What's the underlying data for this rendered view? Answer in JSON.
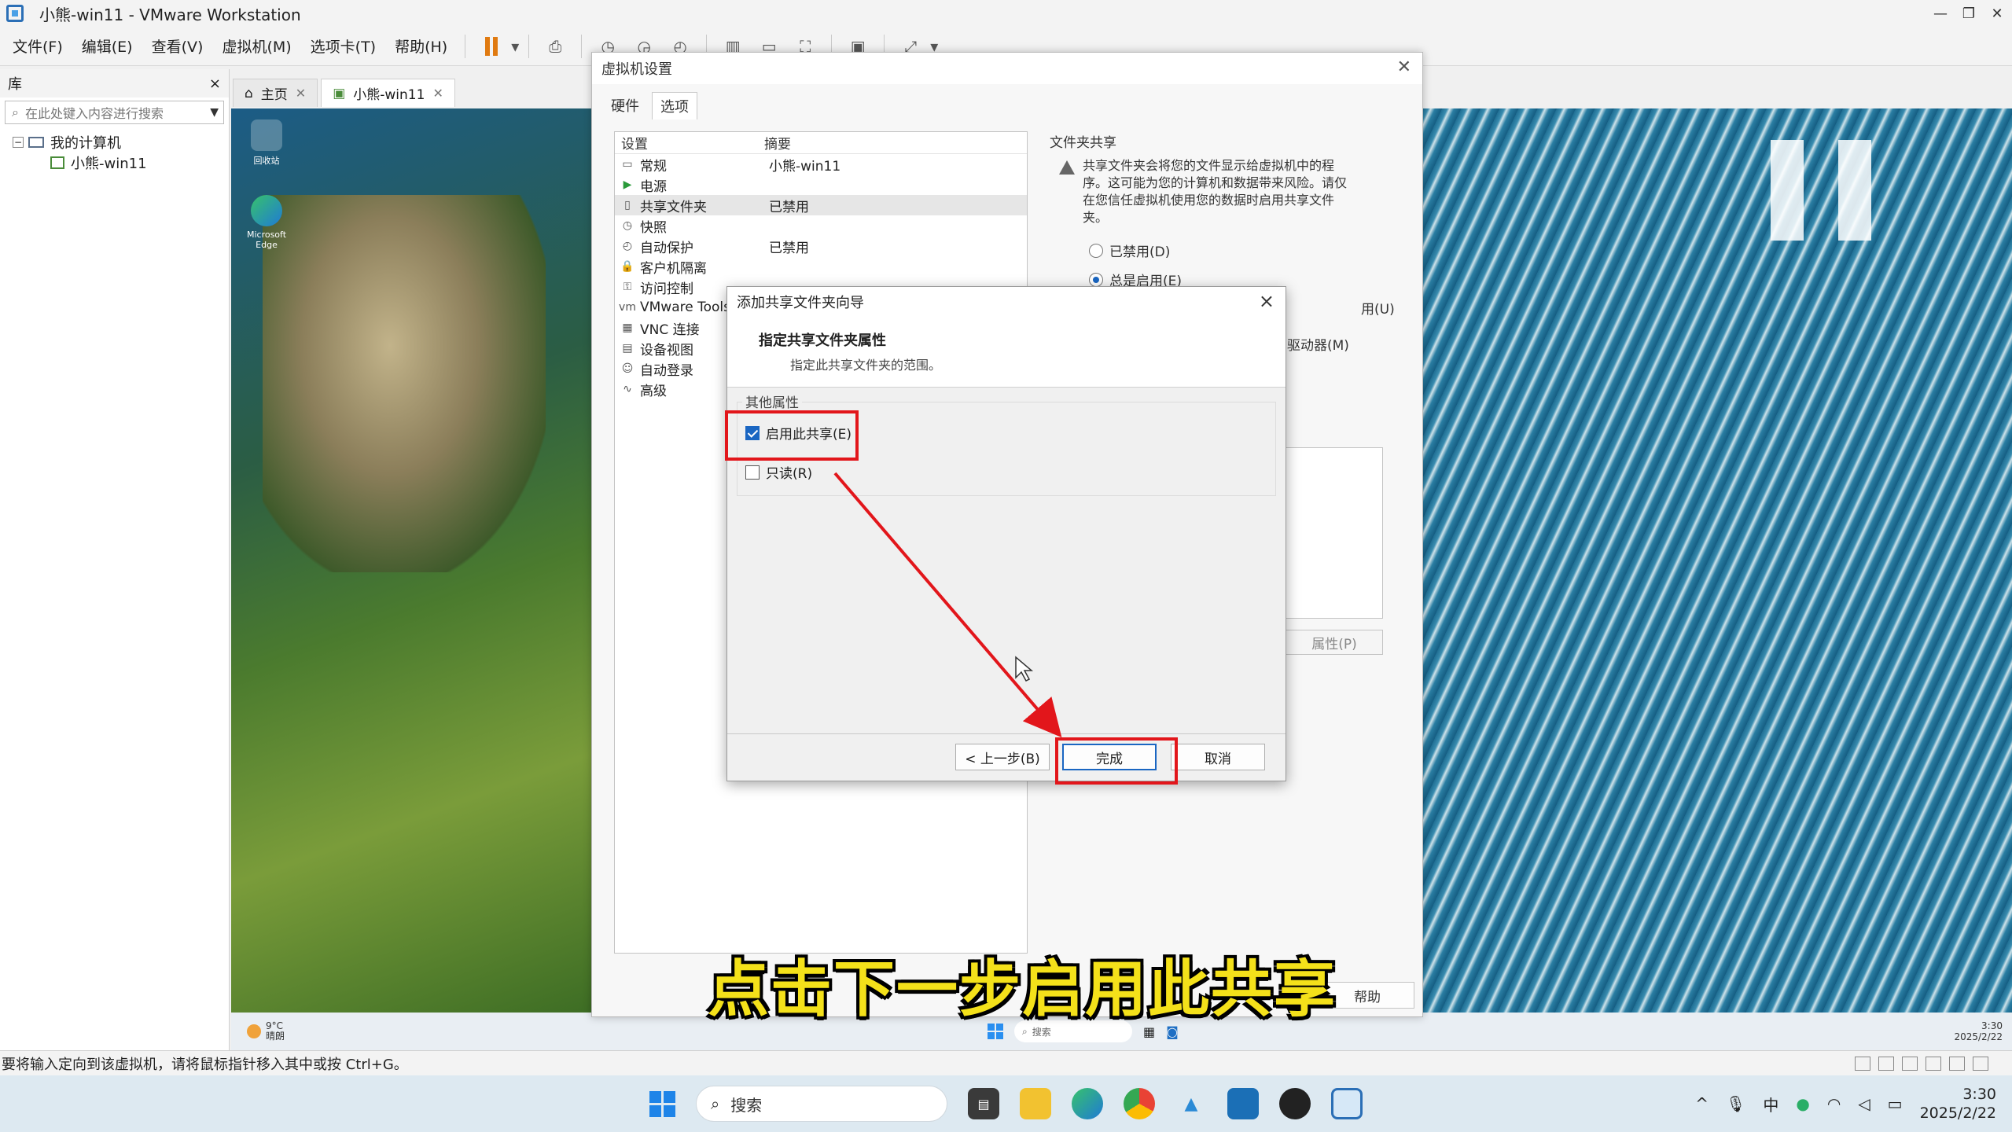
{
  "window": {
    "title": "小熊-win11 - VMware Workstation"
  },
  "menubar": {
    "items": [
      "文件(F)",
      "编辑(E)",
      "查看(V)",
      "虚拟机(M)",
      "选项卡(T)",
      "帮助(H)"
    ]
  },
  "library": {
    "title": "库",
    "close": "×",
    "search_placeholder": "在此处键入内容进行搜索",
    "tree": {
      "root": "我的计算机",
      "child": "小熊-win11"
    }
  },
  "tabs": [
    {
      "label": "主页"
    },
    {
      "label": "小熊-win11"
    }
  ],
  "guest": {
    "desktop_icons": [
      "回收站",
      "Microsoft Edge"
    ],
    "weather": "9°C",
    "weather_sub": "晴朗",
    "search": "搜索",
    "time": "3:30",
    "date": "2025/2/22"
  },
  "vm_settings": {
    "title": "虚拟机设置",
    "tabs": [
      "硬件",
      "选项"
    ],
    "active_tab": "选项",
    "list_header": {
      "col1": "设置",
      "col2": "摘要"
    },
    "items": [
      {
        "name": "常规",
        "summary": "小熊-win11",
        "icon": "monitor-icon"
      },
      {
        "name": "电源",
        "summary": "",
        "icon": "play-icon"
      },
      {
        "name": "共享文件夹",
        "summary": "已禁用",
        "icon": "folder-share-icon"
      },
      {
        "name": "快照",
        "summary": "",
        "icon": "snapshot-icon"
      },
      {
        "name": "自动保护",
        "summary": "已禁用",
        "icon": "clock-icon"
      },
      {
        "name": "客户机隔离",
        "summary": "",
        "icon": "lock-icon"
      },
      {
        "name": "访问控制",
        "summary": "",
        "icon": "key-icon"
      },
      {
        "name": "VMware Tools",
        "summary": "",
        "icon": "vm-tools-icon"
      },
      {
        "name": "VNC 连接",
        "summary": "",
        "icon": "vnc-icon"
      },
      {
        "name": "设备视图",
        "summary": "",
        "icon": "device-view-icon"
      },
      {
        "name": "自动登录",
        "summary": "",
        "icon": "autologin-icon"
      },
      {
        "name": "高级",
        "summary": "",
        "icon": "advanced-icon"
      }
    ],
    "folder_sharing": {
      "title": "文件夹共享",
      "warning": "共享文件夹会将您的文件显示给虚拟机中的程序。这可能为您的计算机和数据带来风险。请仅在您信任虚拟机使用您的数据时启用共享文件夹。",
      "radio_disabled": "已禁用(D)",
      "radio_always": "总是启用(E)",
      "partial_1": "用(U)",
      "partial_2": "驱动器(M)",
      "properties": "属性(P)"
    },
    "help": "帮助"
  },
  "wizard": {
    "title": "添加共享文件夹向导",
    "close": "×",
    "heading": "指定共享文件夹属性",
    "subheading": "指定此共享文件夹的范围。",
    "group_title": "其他属性",
    "enable_share": {
      "label": "启用此共享(E)",
      "checked": true
    },
    "read_only": {
      "label": "只读(R)",
      "checked": false
    },
    "buttons": {
      "back": "< 上一步(B)",
      "finish": "完成",
      "cancel": "取消"
    }
  },
  "subtitle": "点击下一步启用此共享",
  "status_bar": {
    "text": "要将输入定向到该虚拟机，请将鼠标指针移入其中或按 Ctrl+G。"
  },
  "host_taskbar": {
    "search": "搜索",
    "ime": "中",
    "time": "3:30",
    "date": "2025/2/22"
  },
  "colors": {
    "highlight": "#e2161b",
    "subtitle": "#f4e11a",
    "accent": "#1a66c2"
  }
}
